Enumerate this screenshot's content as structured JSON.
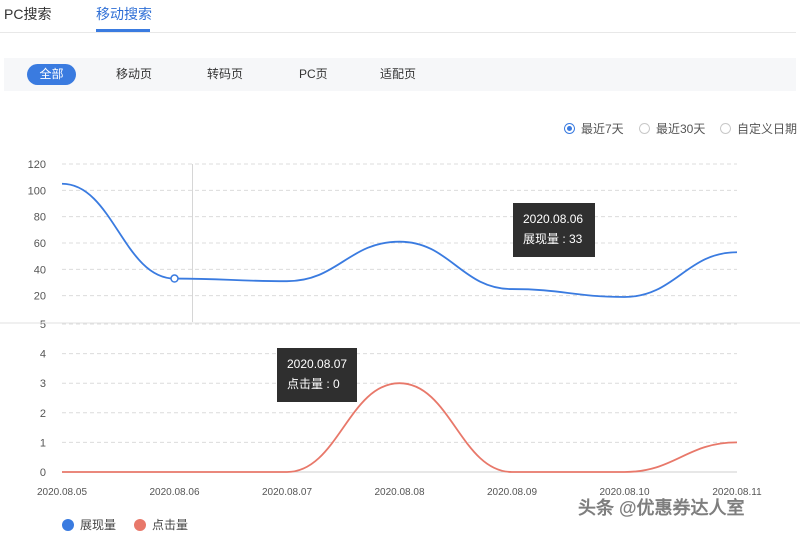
{
  "tabs": [
    {
      "label": "PC搜索"
    },
    {
      "label": "移动搜索"
    }
  ],
  "filters": [
    {
      "label": "全部"
    },
    {
      "label": "移动页"
    },
    {
      "label": "转码页"
    },
    {
      "label": "PC页"
    },
    {
      "label": "适配页"
    }
  ],
  "ranges": [
    {
      "label": "最近7天"
    },
    {
      "label": "最近30天"
    },
    {
      "label": "自定义日期"
    }
  ],
  "colors": {
    "impressions": "#3a7be0",
    "clicks": "#e8786a",
    "accent": "#3a7be0"
  },
  "tooltips": {
    "top": {
      "date": "2020.08.06",
      "text": "展现量 : 33"
    },
    "bottom": {
      "date": "2020.08.07",
      "text": "点击量 : 0"
    }
  },
  "legend": [
    {
      "label": "展现量"
    },
    {
      "label": "点击量"
    }
  ],
  "watermark": "头条 @优惠券达人室",
  "chart_data": [
    {
      "type": "line",
      "x": [
        "2020.08.05",
        "2020.08.06",
        "2020.08.07",
        "2020.08.08",
        "2020.08.09",
        "2020.08.10",
        "2020.08.11"
      ],
      "yticks": [
        20,
        40,
        60,
        80,
        100,
        120
      ],
      "ylim": [
        0,
        120
      ],
      "series": [
        {
          "name": "展现量",
          "values": [
            105,
            33,
            31,
            61,
            25,
            19,
            53
          ]
        }
      ],
      "grid": true
    },
    {
      "type": "line",
      "x": [
        "2020.08.05",
        "2020.08.06",
        "2020.08.07",
        "2020.08.08",
        "2020.08.09",
        "2020.08.10",
        "2020.08.11"
      ],
      "yticks": [
        0,
        1,
        2,
        3,
        4,
        5
      ],
      "ylim": [
        0,
        5
      ],
      "series": [
        {
          "name": "点击量",
          "values": [
            0,
            0,
            0,
            3,
            0,
            0,
            1
          ]
        }
      ],
      "grid": true
    }
  ]
}
